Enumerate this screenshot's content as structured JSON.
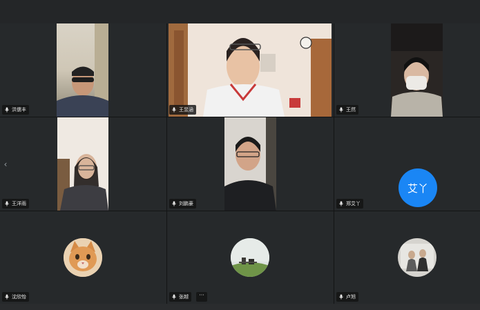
{
  "participants": [
    {
      "name": "洪儒丰",
      "type": "video"
    },
    {
      "name": "王昱涵",
      "type": "video"
    },
    {
      "name": "王然",
      "type": "video"
    },
    {
      "name": "王洋雨",
      "type": "video"
    },
    {
      "name": "刘鹏豪",
      "type": "video"
    },
    {
      "name": "郑艾丫",
      "type": "initials",
      "initials": "艾丫",
      "color": "#1a86f5"
    },
    {
      "name": "沈欣怡",
      "type": "avatar",
      "avatar": "cat-photo"
    },
    {
      "name": "张越",
      "type": "avatar",
      "avatar": "landscape-photo"
    },
    {
      "name": "卢旭",
      "type": "avatar",
      "avatar": "group-photo"
    }
  ],
  "controls": {
    "more_label": "···",
    "prev_page_label": "‹"
  },
  "icons": {
    "mic": "mic-icon",
    "more": "more-icon",
    "prev": "chevron-left-icon"
  }
}
